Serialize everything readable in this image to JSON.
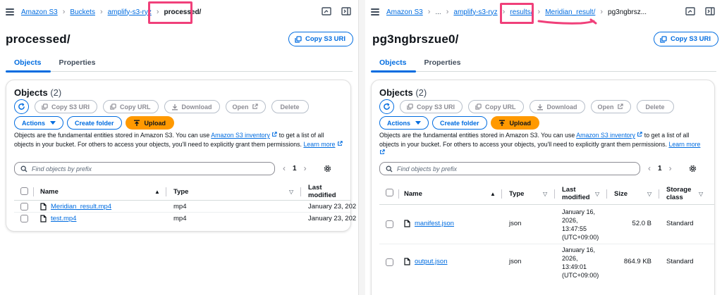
{
  "left": {
    "breadcrumb": [
      "Amazon S3",
      "Buckets",
      "amplify-s3-ryz",
      "processed/"
    ],
    "title": "processed/",
    "copy_uri_label": "Copy S3 URI",
    "tabs": [
      "Objects",
      "Properties"
    ],
    "objects_heading": "Objects",
    "objects_count": "(2)",
    "buttons": {
      "copy_s3_uri": "Copy S3 URI",
      "copy_url": "Copy URL",
      "download": "Download",
      "open": "Open",
      "delete": "Delete",
      "actions": "Actions",
      "create_folder": "Create folder",
      "upload": "Upload"
    },
    "description": {
      "part1": "Objects are the fundamental entities stored in Amazon S3. You can use ",
      "link1": "Amazon S3 inventory",
      "part2": " to get a list of all objects in your bucket. For others to access your objects, you'll need to explicitly grant them permissions. ",
      "link2": "Learn more"
    },
    "search_placeholder": "Find objects by prefix",
    "page": "1",
    "columns": [
      "Name",
      "Type",
      "Last modified"
    ],
    "rows": [
      {
        "name": "Meridian_result.mp4",
        "type": "mp4",
        "modified": "January 23, 202"
      },
      {
        "name": "test.mp4",
        "type": "mp4",
        "modified": "January 23, 202"
      }
    ]
  },
  "right": {
    "breadcrumb": [
      "Amazon S3",
      "...",
      "amplify-s3-ryz",
      "results/",
      "Meridian_result/",
      "pg3ngbrsz..."
    ],
    "title": "pg3ngbrszue0/",
    "copy_uri_label": "Copy S3 URI",
    "tabs": [
      "Objects",
      "Properties"
    ],
    "objects_heading": "Objects",
    "objects_count": "(2)",
    "buttons": {
      "copy_s3_uri": "Copy S3 URI",
      "copy_url": "Copy URL",
      "download": "Download",
      "open": "Open",
      "delete": "Delete",
      "actions": "Actions",
      "create_folder": "Create folder",
      "upload": "Upload"
    },
    "description": {
      "part1": "Objects are the fundamental entities stored in Amazon S3. You can use ",
      "link1": "Amazon S3 inventory",
      "part2": " to get a list of all objects in your bucket. For others to access your objects, you'll need to explicitly grant them permissions. ",
      "link2": "Learn more"
    },
    "search_placeholder": "Find objects by prefix",
    "page": "1",
    "columns": [
      "Name",
      "Type",
      "Last modified",
      "Size",
      "Storage class"
    ],
    "rows": [
      {
        "name": "manifest.json",
        "type": "json",
        "modified": "January 16, 2026, 13:47:55 (UTC+09:00)",
        "size": "52.0 B",
        "storage": "Standard"
      },
      {
        "name": "output.json",
        "type": "json",
        "modified": "January 16, 2026, 13:49:01 (UTC+09:00)",
        "size": "864.9 KB",
        "storage": "Standard"
      }
    ]
  },
  "icons": {
    "menu": "hamburger-icon",
    "split": "split-view-icon",
    "panel": "side-panel-icon",
    "copy": "copy-icon",
    "download": "download-icon",
    "external": "external-link-icon",
    "refresh": "refresh-icon",
    "upload": "upload-icon",
    "search": "search-icon",
    "settings": "gear-icon",
    "file": "file-icon"
  },
  "colors": {
    "link": "#006ce0",
    "upload": "#ff9900",
    "highlight": "#f0407a"
  }
}
